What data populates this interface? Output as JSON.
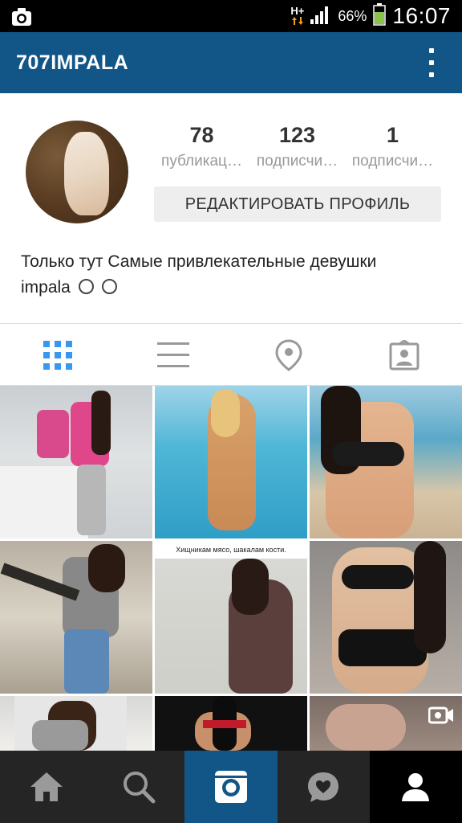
{
  "status_bar": {
    "network_type": "H+",
    "battery_percent": "66%",
    "time": "16:07"
  },
  "header": {
    "username": "707IMPALA",
    "menu_icon": "overflow-menu-icon"
  },
  "profile": {
    "stats": [
      {
        "value": "78",
        "label": "публикац…"
      },
      {
        "value": "123",
        "label": "подписчи…"
      },
      {
        "value": "1",
        "label": "подписчи…"
      }
    ],
    "edit_button_label": "РЕДАКТИРОВАТЬ ПРОФИЛЬ",
    "bio_line1": "Только тут Самые привлекательные девушки",
    "bio_line2": "impala"
  },
  "tabs": [
    {
      "icon": "grid-view-icon",
      "active": true
    },
    {
      "icon": "list-view-icon",
      "active": false
    },
    {
      "icon": "location-pin-icon",
      "active": false
    },
    {
      "icon": "tagged-photos-icon",
      "active": false
    }
  ],
  "grid": {
    "caption_overlay": "Хищникам мясо, шакалам кости."
  },
  "bottom_nav": [
    {
      "icon": "home-icon"
    },
    {
      "icon": "search-icon"
    },
    {
      "icon": "camera-icon"
    },
    {
      "icon": "activity-heart-icon"
    },
    {
      "icon": "profile-icon"
    }
  ],
  "colors": {
    "header_bg": "#125688",
    "accent_blue": "#3897f0",
    "bottom_nav_bg": "#252525"
  }
}
